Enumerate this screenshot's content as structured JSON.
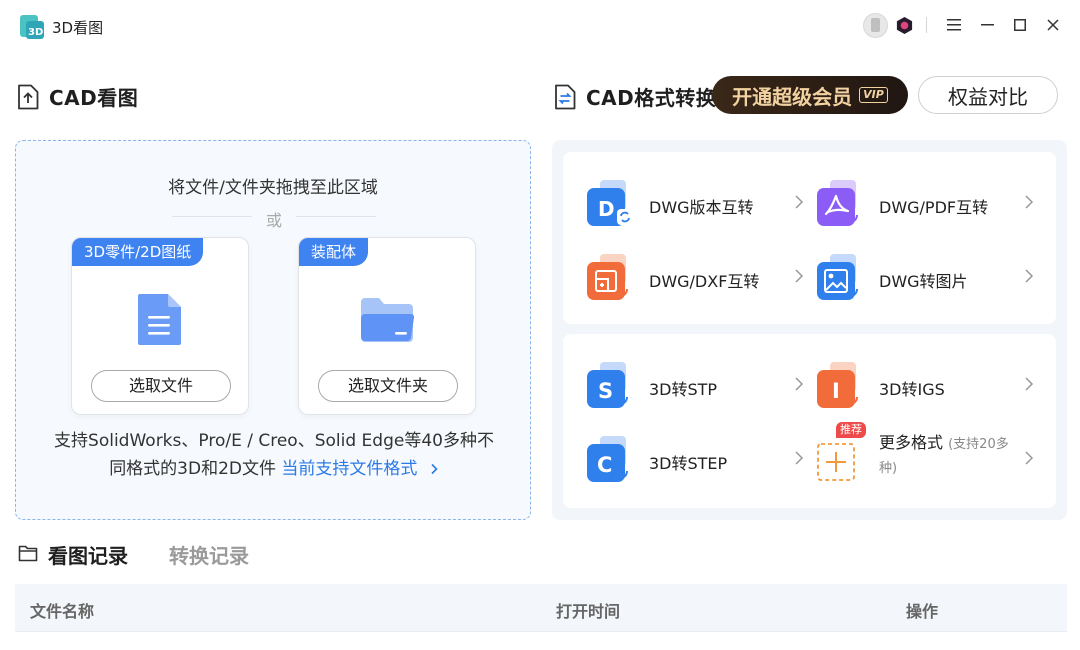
{
  "app": {
    "title": "3D看图"
  },
  "sections": {
    "view_title": "CAD看图",
    "convert_title": "CAD格式转换",
    "vip_label": "开通超级会员",
    "vip_tag": "VIP",
    "compare_label": "权益对比"
  },
  "dropzone": {
    "title": "将文件/文件夹拖拽至此区域",
    "or": "或",
    "cards": [
      {
        "tag": "3D零件/2D图纸",
        "button": "选取文件",
        "icon": "document-icon"
      },
      {
        "tag": "装配体",
        "button": "选取文件夹",
        "icon": "folder-icon"
      }
    ],
    "support_line1": "支持SolidWorks、Pro/E / Creo、Solid Edge等40多种不",
    "support_line2": "同格式的3D和2D文件",
    "support_link": "当前支持文件格式"
  },
  "conversions": {
    "group1": [
      {
        "label": "DWG版本互转",
        "icon": "dwg-version-icon",
        "color": "#2f80ed"
      },
      {
        "label": "DWG/PDF互转",
        "icon": "pdf-icon",
        "color": "#8b5cf6"
      },
      {
        "label": "DWG/DXF互转",
        "icon": "dxf-icon",
        "color": "#f26b3a"
      },
      {
        "label": "DWG转图片",
        "icon": "image-icon",
        "color": "#2f80ed"
      }
    ],
    "group2": [
      {
        "label": "3D转STP",
        "icon": "stp-icon",
        "letter": "S",
        "color": "#2f80ed"
      },
      {
        "label": "3D转IGS",
        "icon": "igs-icon",
        "letter": "I",
        "color": "#f26b3a"
      },
      {
        "label": "3D转STEP",
        "icon": "step-icon",
        "letter": "C",
        "color": "#2f80ed"
      }
    ],
    "more": {
      "label": "更多格式",
      "note": "(支持20多种)",
      "badge": "推荐"
    }
  },
  "records": {
    "tab_view": "看图记录",
    "tab_convert": "转换记录",
    "columns": [
      "文件名称",
      "打开时间",
      "操作"
    ]
  }
}
